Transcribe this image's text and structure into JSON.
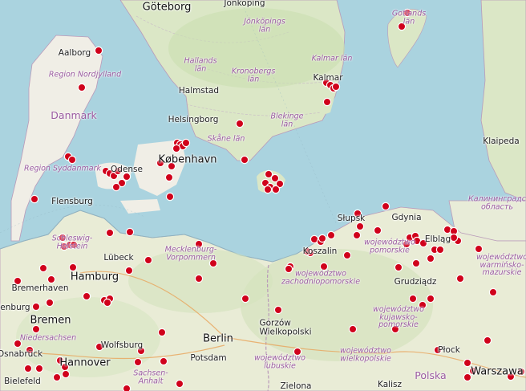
{
  "map": {
    "countries": [
      {
        "id": "denmark",
        "label": "Danmark"
      },
      {
        "id": "poland",
        "label": "Polska"
      }
    ],
    "regions": [
      {
        "id": "region-nordjylland",
        "label": "Region Nordjylland"
      },
      {
        "id": "region-syddanmark",
        "label": "Region Syddanmark"
      },
      {
        "id": "hallands-lan",
        "label": "Hallands\nlän"
      },
      {
        "id": "jonkopings-lan",
        "label": "Jönköpings\nlän"
      },
      {
        "id": "kronobergs-lan",
        "label": "Kronobergs\nlän"
      },
      {
        "id": "kalmar-lan",
        "label": "Kalmar län"
      },
      {
        "id": "blekinge-lan",
        "label": "Blekinge\nlän"
      },
      {
        "id": "skane-lan",
        "label": "Skåne län"
      },
      {
        "id": "gotlands-lan",
        "label": "Gotlands\nlän"
      },
      {
        "id": "schleswig-holstein",
        "label": "Schleswig-\nHolstein"
      },
      {
        "id": "mecklenburg-vorpommern",
        "label": "Mecklenburg-\nVorpommern"
      },
      {
        "id": "niedersachsen",
        "label": "Niedersachsen"
      },
      {
        "id": "sachsen-anhalt",
        "label": "Sachsen-\nAnhalt"
      },
      {
        "id": "wojewodztwo-pomorskie",
        "label": "województwo\npomorskie"
      },
      {
        "id": "wojewodztwo-zachodniopomorskie",
        "label": "województwo\nzachodniopomorskie"
      },
      {
        "id": "wojewodztwo-warminsko-mazurskie",
        "label": "województwo\nwarmińsko-\nmazurskie"
      },
      {
        "id": "wojewodztwo-kujawsko-pomorskie",
        "label": "województwo\nkujawsko-\npomorskie"
      },
      {
        "id": "wojewodztwo-lubuskie",
        "label": "województwo\nlubuskie"
      },
      {
        "id": "wojewodztwo-wielkopolskie",
        "label": "województwo\nwielkopolskie"
      },
      {
        "id": "kaliningrad-oblast",
        "label": "Калининградс\nобласть"
      }
    ],
    "cities": [
      {
        "id": "goteborg",
        "label": "Göteborg",
        "big": true
      },
      {
        "id": "jonkoping",
        "label": "Jönköping",
        "big": false
      },
      {
        "id": "aalborg",
        "label": "Aalborg",
        "big": false
      },
      {
        "id": "halmstad",
        "label": "Halmstad",
        "big": false
      },
      {
        "id": "kalmar",
        "label": "Kalmar",
        "big": false
      },
      {
        "id": "helsingborg",
        "label": "Helsingborg",
        "big": false
      },
      {
        "id": "kobenhavn",
        "label": "København",
        "big": true
      },
      {
        "id": "odense",
        "label": "Odense",
        "big": false
      },
      {
        "id": "flensburg",
        "label": "Flensburg",
        "big": false
      },
      {
        "id": "klaipeda",
        "label": "Klaipeda",
        "big": false
      },
      {
        "id": "slupsk",
        "label": "Słupsk",
        "big": false
      },
      {
        "id": "gdynia",
        "label": "Gdynia",
        "big": false
      },
      {
        "id": "koszalin",
        "label": "Koszalin",
        "big": false
      },
      {
        "id": "elblag",
        "label": "Elbląg",
        "big": false
      },
      {
        "id": "lubeck",
        "label": "Lübeck",
        "big": false
      },
      {
        "id": "bremerhaven",
        "label": "Bremerhaven",
        "big": false
      },
      {
        "id": "hamburg",
        "label": "Hamburg",
        "big": true
      },
      {
        "id": "oldenburg",
        "label": "Oldenburg",
        "big": false
      },
      {
        "id": "bremen",
        "label": "Bremen",
        "big": true
      },
      {
        "id": "grudziadz",
        "label": "Grudziądz",
        "big": false
      },
      {
        "id": "gorzow",
        "label": "Gorzów\nWielkopolski",
        "big": false
      },
      {
        "id": "berlin",
        "label": "Berlin",
        "big": true
      },
      {
        "id": "potsdam",
        "label": "Potsdam",
        "big": false
      },
      {
        "id": "wolfsburg",
        "label": "Wolfsburg",
        "big": false
      },
      {
        "id": "osnabruck",
        "label": "Osnabrück",
        "big": false
      },
      {
        "id": "hannover",
        "label": "Hannover",
        "big": true
      },
      {
        "id": "bielefeld",
        "label": "Bielefeld",
        "big": false
      },
      {
        "id": "plock",
        "label": "Płock",
        "big": false
      },
      {
        "id": "warszawa",
        "label": "Warszawa",
        "big": true
      },
      {
        "id": "zielona",
        "label": "Zielona",
        "big": false
      },
      {
        "id": "kalisz",
        "label": "Kalisz",
        "big": false
      }
    ],
    "marker_color": "#d0021b",
    "land_color": "#f0eee6",
    "forest_color": "#c9dfb0",
    "water_color": "#aad3df"
  }
}
